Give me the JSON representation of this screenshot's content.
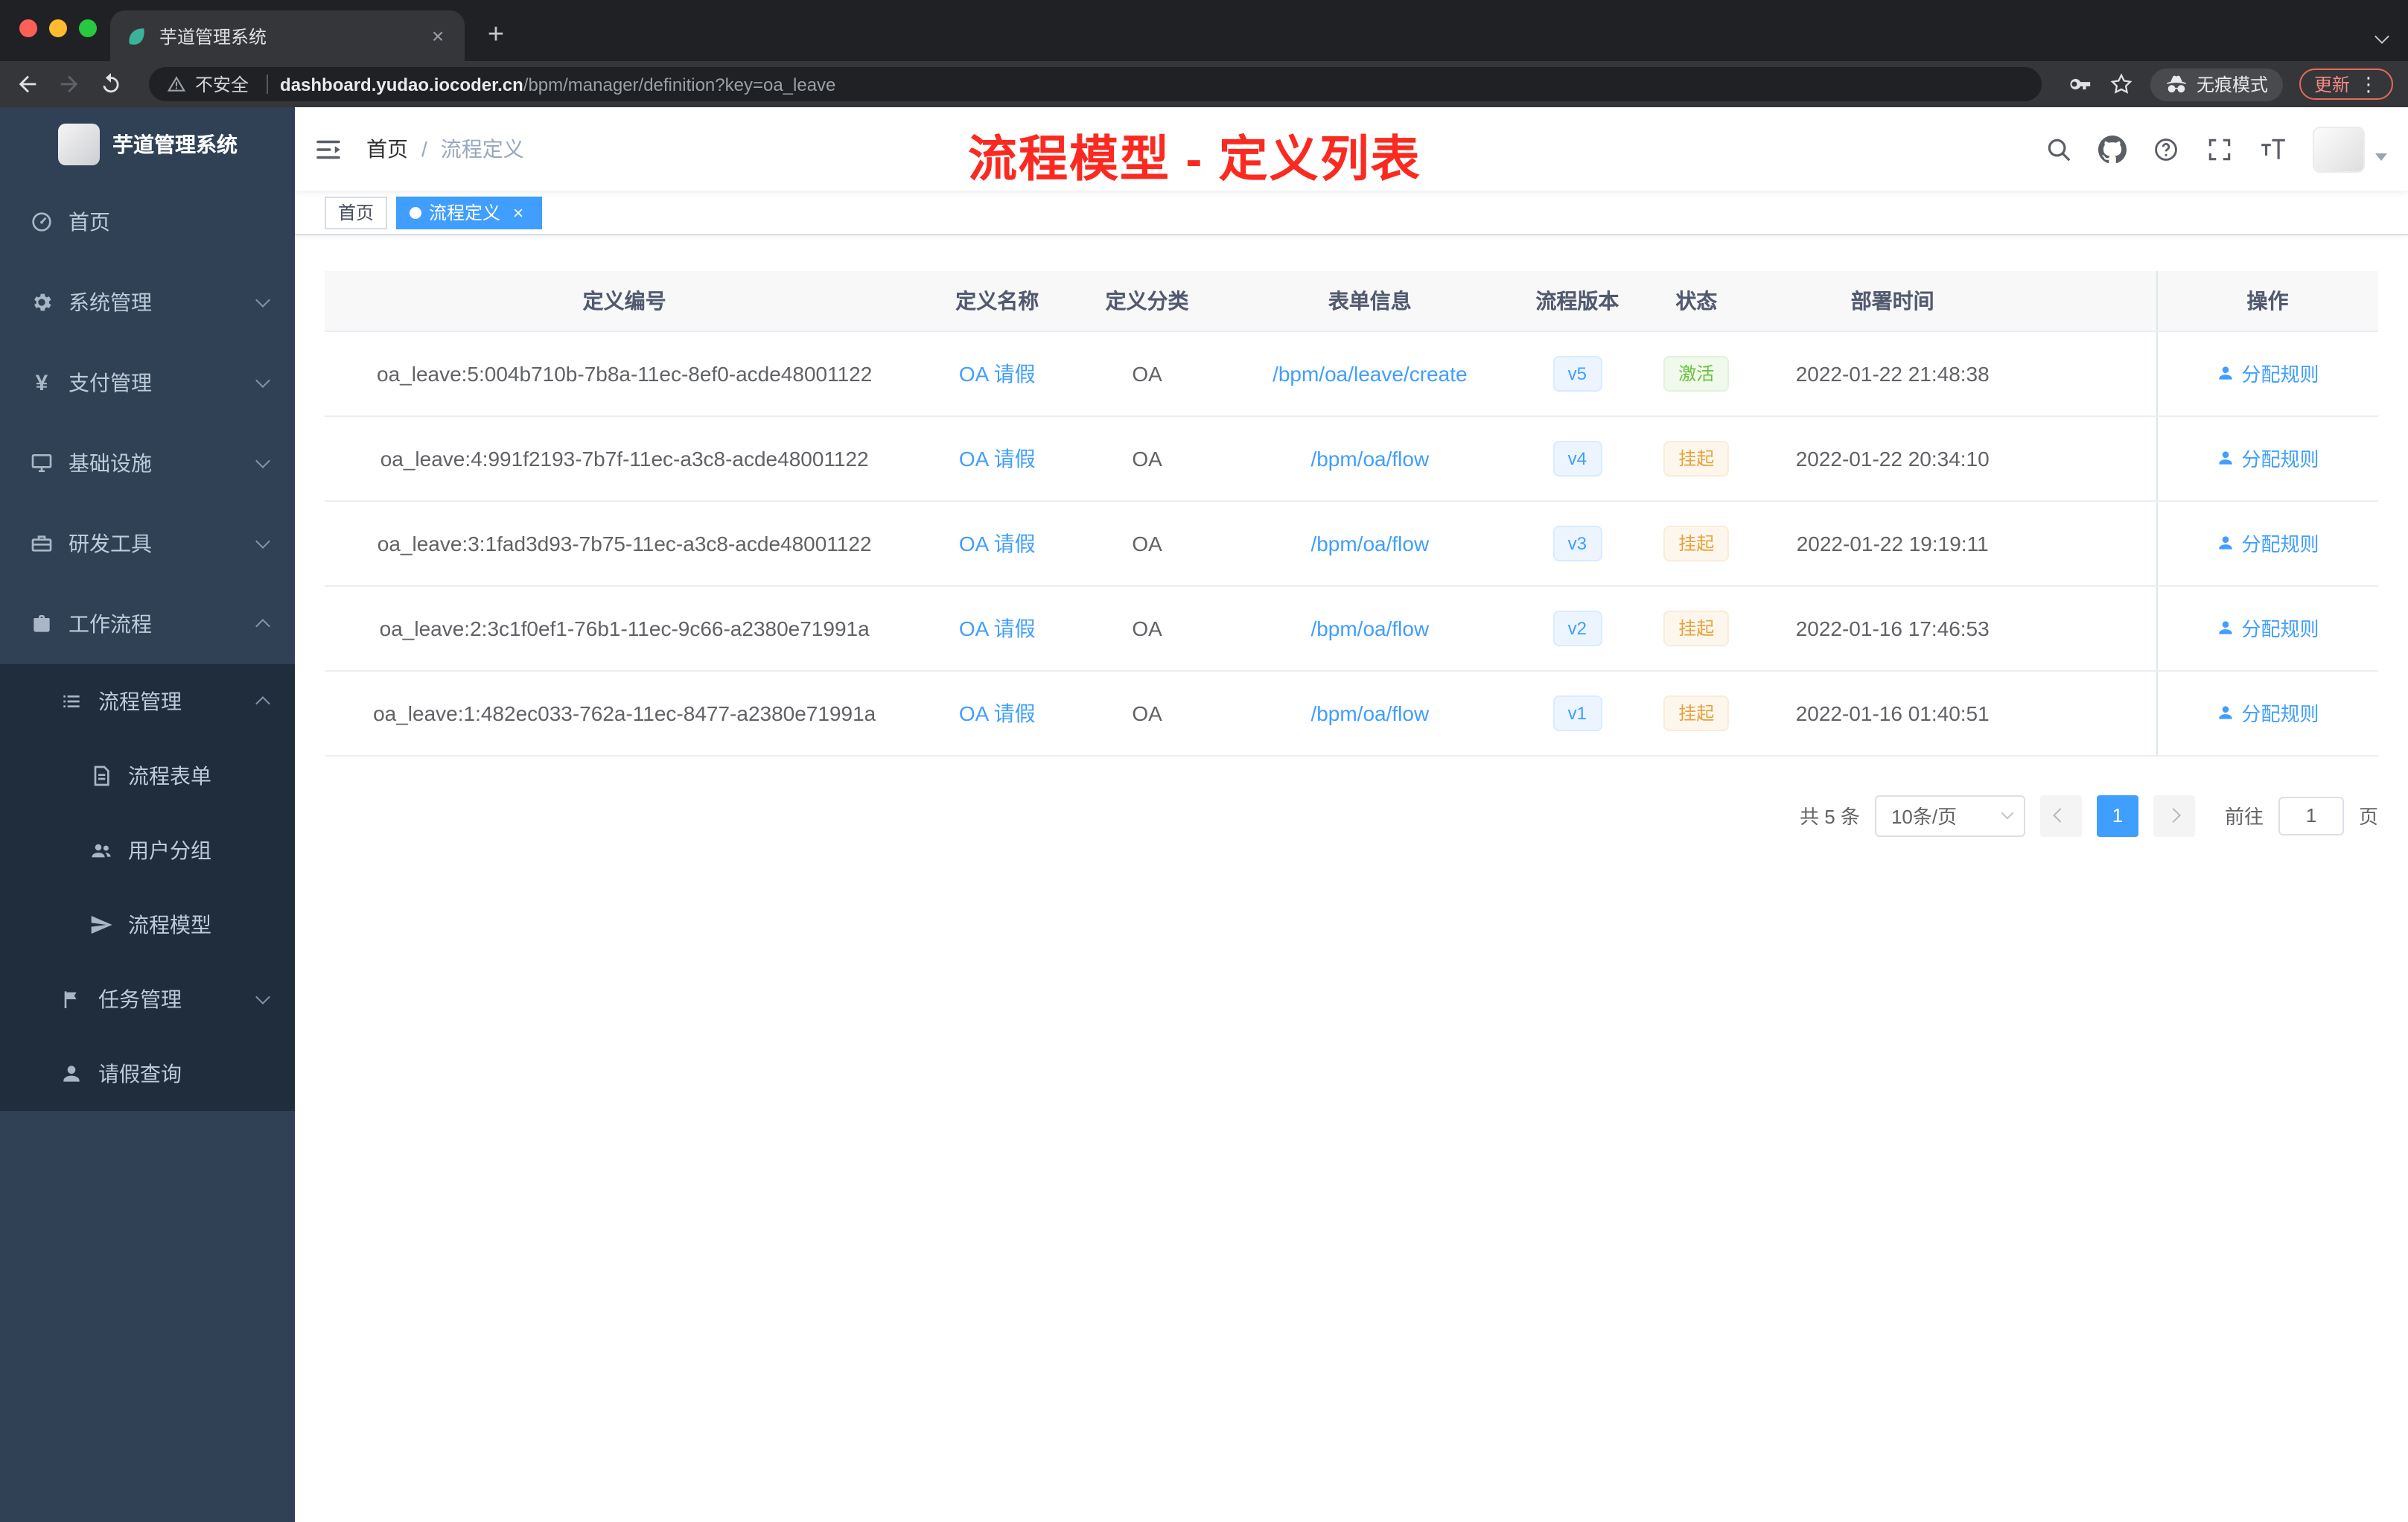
{
  "colors": {
    "accent": "#409eff",
    "success": "#67c23a",
    "warning": "#e6a23c",
    "annotation_red": "#fb2a20",
    "sidebar_bg": "#304156",
    "sidebar_submenu_bg": "#1f2d3d",
    "mac_close": "#ff5f57",
    "mac_minimize": "#febc2e",
    "mac_zoom": "#28c840"
  },
  "icons": {
    "close_glyph": "×",
    "new_tab_glyph": "+",
    "more_glyph": "⋮",
    "yen_glyph": "¥",
    "breadcrumb_separator": "/"
  },
  "browser": {
    "tab_title": "芋道管理系统",
    "security_label": "不安全",
    "url_domain": "dashboard.yudao.iocoder.cn",
    "url_path": "/bpm/manager/definition?key=oa_leave",
    "incognito_label": "无痕模式",
    "update_label": "更新"
  },
  "sidebar": {
    "app_title": "芋道管理系统",
    "top_items": [
      {
        "label": "首页",
        "icon": "dashboard-icon"
      },
      {
        "label": "系统管理",
        "icon": "gear-icon"
      },
      {
        "label": "支付管理",
        "icon": "yen-icon"
      },
      {
        "label": "基础设施",
        "icon": "infrastructure-icon"
      },
      {
        "label": "研发工具",
        "icon": "tools-icon"
      },
      {
        "label": "工作流程",
        "icon": "workflow-icon"
      }
    ],
    "workflow_children": {
      "process_management": {
        "label": "流程管理",
        "icon": "process-management-icon"
      },
      "process_items": [
        {
          "label": "流程表单",
          "icon": "form-icon"
        },
        {
          "label": "用户分组",
          "icon": "user-group-icon"
        },
        {
          "label": "流程模型",
          "icon": "paper-plane-icon"
        }
      ],
      "task_management": {
        "label": "任务管理",
        "icon": "task-icon"
      },
      "leave_query": {
        "label": "请假查询",
        "icon": "user-icon"
      }
    }
  },
  "header": {
    "breadcrumb_home": "首页",
    "breadcrumb_current": "流程定义",
    "annotation": "流程模型 - 定义列表"
  },
  "tags_view": {
    "home_label": "首页",
    "active_label": "流程定义"
  },
  "table": {
    "columns": [
      "定义编号",
      "定义名称",
      "定义分类",
      "表单信息",
      "流程版本",
      "状态",
      "部署时间",
      "操作"
    ],
    "action_label": "分配规则",
    "rows": [
      {
        "id": "oa_leave:5:004b710b-7b8a-11ec-8ef0-acde48001122",
        "name": "OA 请假",
        "category": "OA",
        "form": "/bpm/oa/leave/create",
        "version": "v5",
        "status": "激活",
        "status_type": "success",
        "deployed": "2022-01-22 21:48:38"
      },
      {
        "id": "oa_leave:4:991f2193-7b7f-11ec-a3c8-acde48001122",
        "name": "OA 请假",
        "category": "OA",
        "form": "/bpm/oa/flow",
        "version": "v4",
        "status": "挂起",
        "status_type": "warning",
        "deployed": "2022-01-22 20:34:10"
      },
      {
        "id": "oa_leave:3:1fad3d93-7b75-11ec-a3c8-acde48001122",
        "name": "OA 请假",
        "category": "OA",
        "form": "/bpm/oa/flow",
        "version": "v3",
        "status": "挂起",
        "status_type": "warning",
        "deployed": "2022-01-22 19:19:11"
      },
      {
        "id": "oa_leave:2:3c1f0ef1-76b1-11ec-9c66-a2380e71991a",
        "name": "OA 请假",
        "category": "OA",
        "form": "/bpm/oa/flow",
        "version": "v2",
        "status": "挂起",
        "status_type": "warning",
        "deployed": "2022-01-16 17:46:53"
      },
      {
        "id": "oa_leave:1:482ec033-762a-11ec-8477-a2380e71991a",
        "name": "OA 请假",
        "category": "OA",
        "form": "/bpm/oa/flow",
        "version": "v1",
        "status": "挂起",
        "status_type": "warning",
        "deployed": "2022-01-16 01:40:51"
      }
    ]
  },
  "pagination": {
    "total_label": "共 5 条",
    "page_size_label": "10条/页",
    "current_page": "1",
    "goto_label": "前往",
    "goto_value": "1",
    "page_unit_label": "页"
  }
}
